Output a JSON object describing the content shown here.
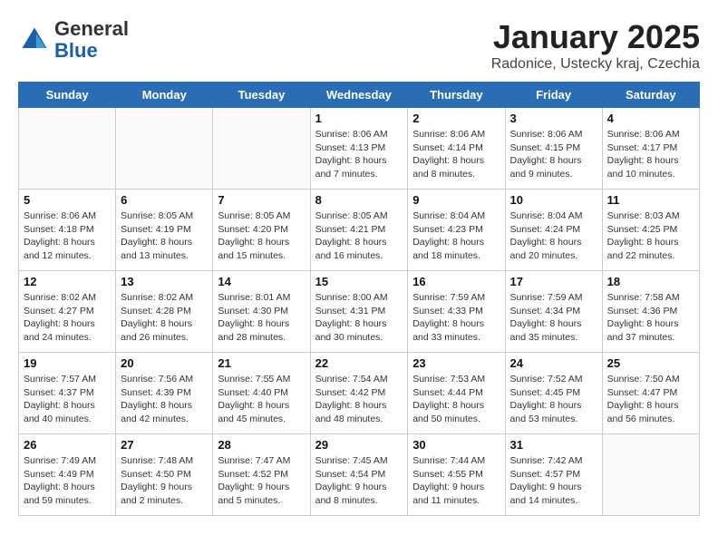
{
  "header": {
    "logo_line1": "General",
    "logo_line2": "Blue",
    "month": "January 2025",
    "location": "Radonice, Ustecky kraj, Czechia"
  },
  "weekdays": [
    "Sunday",
    "Monday",
    "Tuesday",
    "Wednesday",
    "Thursday",
    "Friday",
    "Saturday"
  ],
  "weeks": [
    {
      "days": [
        {
          "num": "",
          "info": ""
        },
        {
          "num": "",
          "info": ""
        },
        {
          "num": "",
          "info": ""
        },
        {
          "num": "1",
          "info": "Sunrise: 8:06 AM\nSunset: 4:13 PM\nDaylight: 8 hours\nand 7 minutes."
        },
        {
          "num": "2",
          "info": "Sunrise: 8:06 AM\nSunset: 4:14 PM\nDaylight: 8 hours\nand 8 minutes."
        },
        {
          "num": "3",
          "info": "Sunrise: 8:06 AM\nSunset: 4:15 PM\nDaylight: 8 hours\nand 9 minutes."
        },
        {
          "num": "4",
          "info": "Sunrise: 8:06 AM\nSunset: 4:17 PM\nDaylight: 8 hours\nand 10 minutes."
        }
      ]
    },
    {
      "days": [
        {
          "num": "5",
          "info": "Sunrise: 8:06 AM\nSunset: 4:18 PM\nDaylight: 8 hours\nand 12 minutes."
        },
        {
          "num": "6",
          "info": "Sunrise: 8:05 AM\nSunset: 4:19 PM\nDaylight: 8 hours\nand 13 minutes."
        },
        {
          "num": "7",
          "info": "Sunrise: 8:05 AM\nSunset: 4:20 PM\nDaylight: 8 hours\nand 15 minutes."
        },
        {
          "num": "8",
          "info": "Sunrise: 8:05 AM\nSunset: 4:21 PM\nDaylight: 8 hours\nand 16 minutes."
        },
        {
          "num": "9",
          "info": "Sunrise: 8:04 AM\nSunset: 4:23 PM\nDaylight: 8 hours\nand 18 minutes."
        },
        {
          "num": "10",
          "info": "Sunrise: 8:04 AM\nSunset: 4:24 PM\nDaylight: 8 hours\nand 20 minutes."
        },
        {
          "num": "11",
          "info": "Sunrise: 8:03 AM\nSunset: 4:25 PM\nDaylight: 8 hours\nand 22 minutes."
        }
      ]
    },
    {
      "days": [
        {
          "num": "12",
          "info": "Sunrise: 8:02 AM\nSunset: 4:27 PM\nDaylight: 8 hours\nand 24 minutes."
        },
        {
          "num": "13",
          "info": "Sunrise: 8:02 AM\nSunset: 4:28 PM\nDaylight: 8 hours\nand 26 minutes."
        },
        {
          "num": "14",
          "info": "Sunrise: 8:01 AM\nSunset: 4:30 PM\nDaylight: 8 hours\nand 28 minutes."
        },
        {
          "num": "15",
          "info": "Sunrise: 8:00 AM\nSunset: 4:31 PM\nDaylight: 8 hours\nand 30 minutes."
        },
        {
          "num": "16",
          "info": "Sunrise: 7:59 AM\nSunset: 4:33 PM\nDaylight: 8 hours\nand 33 minutes."
        },
        {
          "num": "17",
          "info": "Sunrise: 7:59 AM\nSunset: 4:34 PM\nDaylight: 8 hours\nand 35 minutes."
        },
        {
          "num": "18",
          "info": "Sunrise: 7:58 AM\nSunset: 4:36 PM\nDaylight: 8 hours\nand 37 minutes."
        }
      ]
    },
    {
      "days": [
        {
          "num": "19",
          "info": "Sunrise: 7:57 AM\nSunset: 4:37 PM\nDaylight: 8 hours\nand 40 minutes."
        },
        {
          "num": "20",
          "info": "Sunrise: 7:56 AM\nSunset: 4:39 PM\nDaylight: 8 hours\nand 42 minutes."
        },
        {
          "num": "21",
          "info": "Sunrise: 7:55 AM\nSunset: 4:40 PM\nDaylight: 8 hours\nand 45 minutes."
        },
        {
          "num": "22",
          "info": "Sunrise: 7:54 AM\nSunset: 4:42 PM\nDaylight: 8 hours\nand 48 minutes."
        },
        {
          "num": "23",
          "info": "Sunrise: 7:53 AM\nSunset: 4:44 PM\nDaylight: 8 hours\nand 50 minutes."
        },
        {
          "num": "24",
          "info": "Sunrise: 7:52 AM\nSunset: 4:45 PM\nDaylight: 8 hours\nand 53 minutes."
        },
        {
          "num": "25",
          "info": "Sunrise: 7:50 AM\nSunset: 4:47 PM\nDaylight: 8 hours\nand 56 minutes."
        }
      ]
    },
    {
      "days": [
        {
          "num": "26",
          "info": "Sunrise: 7:49 AM\nSunset: 4:49 PM\nDaylight: 8 hours\nand 59 minutes."
        },
        {
          "num": "27",
          "info": "Sunrise: 7:48 AM\nSunset: 4:50 PM\nDaylight: 9 hours\nand 2 minutes."
        },
        {
          "num": "28",
          "info": "Sunrise: 7:47 AM\nSunset: 4:52 PM\nDaylight: 9 hours\nand 5 minutes."
        },
        {
          "num": "29",
          "info": "Sunrise: 7:45 AM\nSunset: 4:54 PM\nDaylight: 9 hours\nand 8 minutes."
        },
        {
          "num": "30",
          "info": "Sunrise: 7:44 AM\nSunset: 4:55 PM\nDaylight: 9 hours\nand 11 minutes."
        },
        {
          "num": "31",
          "info": "Sunrise: 7:42 AM\nSunset: 4:57 PM\nDaylight: 9 hours\nand 14 minutes."
        },
        {
          "num": "",
          "info": ""
        }
      ]
    }
  ]
}
